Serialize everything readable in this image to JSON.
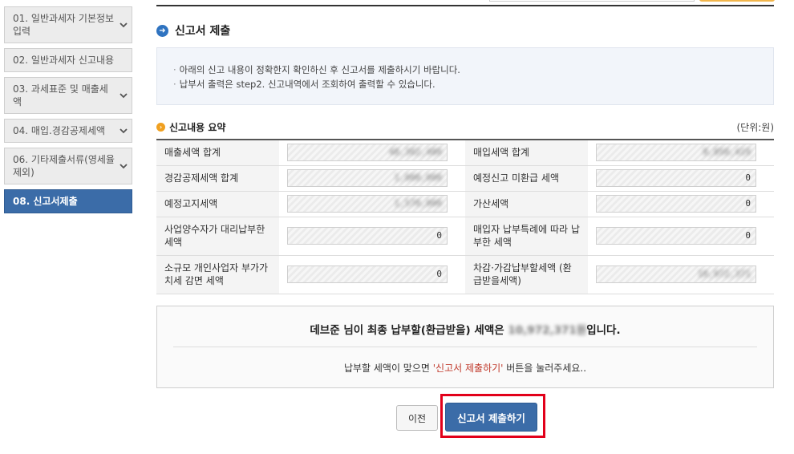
{
  "sidebar": {
    "items": [
      {
        "label": "01. 일반과세자 기본정보 입력",
        "has_chevron": true
      },
      {
        "label": "02. 일반과세자 신고내용",
        "has_chevron": false
      },
      {
        "label": "03. 과세표준 및 매출세액",
        "has_chevron": true
      },
      {
        "label": "04. 매입.경감공제세액",
        "has_chevron": true
      },
      {
        "label": "06. 기타제출서류(영세율 제외)",
        "has_chevron": true
      },
      {
        "label": "08. 신고서제출",
        "has_chevron": false,
        "active": true
      }
    ]
  },
  "page": {
    "title": "신고서 제출"
  },
  "notice": {
    "lines": [
      "아래의 신고 내용이 정확한지 확인하신 후 신고서를 제출하시기 바랍니다.",
      "납부서 출력은 step2. 신고내역에서 조회하여 출력할 수 있습니다."
    ]
  },
  "summary": {
    "title": "신고내용 요약",
    "unit": "(단위:원)",
    "rows": [
      [
        {
          "label": "매출세액 합계",
          "value": "48,302,480",
          "masked": true
        },
        {
          "label": "매입세액 합계",
          "value": "8,850,419",
          "masked": true
        }
      ],
      [
        {
          "label": "경감공제세액 합계",
          "value": "1,000,000",
          "masked": true
        },
        {
          "label": "예정신고 미환급 세액",
          "value": "0",
          "masked": false
        }
      ],
      [
        {
          "label": "예정고지세액",
          "value": "1,570,000",
          "masked": true
        },
        {
          "label": "가산세액",
          "value": "0",
          "masked": false
        }
      ],
      [
        {
          "label": "사업양수자가 대리납부한 세액",
          "value": "0",
          "masked": false
        },
        {
          "label": "매입자 납부특례에 따라 납부한 세액",
          "value": "0",
          "masked": false
        }
      ],
      [
        {
          "label": "소규모 개인사업자 부가가치세 감면 세액",
          "value": "0",
          "masked": false
        },
        {
          "label": "차감·가감납부할세액 (환급받을세액)",
          "value": "10,972,371",
          "masked": true
        }
      ]
    ]
  },
  "final": {
    "name": "데브준",
    "msg_prefix": "님이 최종 납부할(환급받을) 세액은 ",
    "amount": "10,972,371원",
    "msg_suffix": "입니다.",
    "guide_prefix": "납부할 세액이 맞으면 ",
    "guide_highlight": "'신고서 제출하기'",
    "guide_suffix": " 버튼을 눌러주세요.."
  },
  "buttons": {
    "prev": "이전",
    "submit": "신고서 제출하기"
  },
  "colors": {
    "accent": "#3b6ca8",
    "highlight_border": "#e2001a",
    "guide_red": "#c0392b"
  }
}
